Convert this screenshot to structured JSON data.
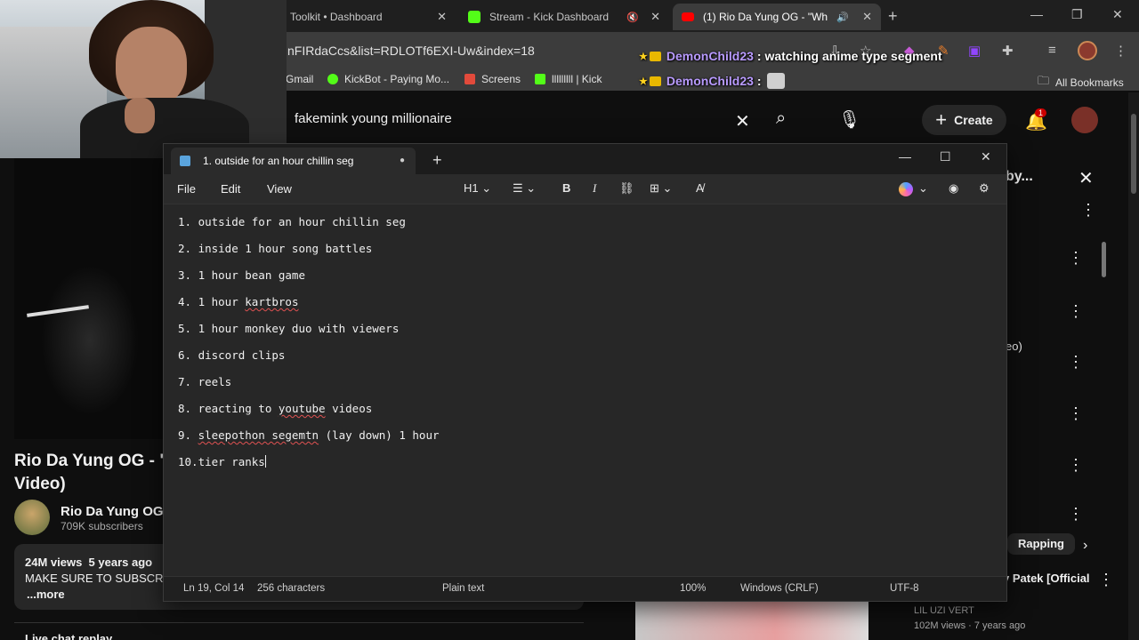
{
  "browser": {
    "tabs": [
      {
        "title": "Toolkit • Dashboard",
        "close": "✕"
      },
      {
        "title": "Stream - Kick Dashboard",
        "close": "✕"
      },
      {
        "title": "(1) Rio Da Yung OG - \"Wha",
        "close": "✕"
      }
    ],
    "new_tab": "+",
    "url": "nFIRdaCcs&list=RDLOTf6EXI-Uw&index=18",
    "bookmarks": [
      {
        "label": "Gmail",
        "icon": "gmail-icon"
      },
      {
        "label": "KickBot - Paying Mo...",
        "icon": "kickbot-icon"
      },
      {
        "label": "Screens",
        "icon": "screens-icon"
      },
      {
        "label": "lllllllll | Kick",
        "icon": "kick-icon"
      }
    ],
    "all_bookmarks": "All Bookmarks"
  },
  "chat": [
    {
      "user": "DemonChild23",
      "message": ": watching anime type segment"
    },
    {
      "user": "DemonChild23",
      "message": ":"
    }
  ],
  "youtube": {
    "search_query": "fakemink young millionaire",
    "create_label": "Create",
    "notification_count": "1",
    "video_title_line1": "Rio Da Yung OG - \"",
    "video_title_line2": "Video)",
    "channel_name": "Rio Da Yung OG",
    "subscribers": "709K subscribers",
    "views_line": "24M views  5 years ago",
    "description": "MAKE SURE TO SUBSCRI",
    "more": "...more",
    "live_chat": "Live chat replay",
    "panel_title": "by...",
    "panel_edge_text": "eo)",
    "chip_label": "Rapping",
    "rec_title": "y Patek [Official",
    "rec_channel": "LIL UZI VERT",
    "rec_meta": "102M views · 7 years ago"
  },
  "notepad": {
    "tab_title": "1. outside for an hour chillin seg",
    "menus": [
      "File",
      "Edit",
      "View"
    ],
    "heading_select": "H1",
    "lines": [
      {
        "num": "1. ",
        "text": "outside for an hour chillin seg"
      },
      {
        "num": "2. ",
        "text": "inside 1 hour song battles"
      },
      {
        "num": "3. ",
        "text": "1 hour bean game"
      },
      {
        "num": "4. ",
        "pre": "1 hour ",
        "squig": "kartbros",
        "post": ""
      },
      {
        "num": "5. ",
        "text": "1 hour monkey duo with viewers"
      },
      {
        "num": "6. ",
        "text": "discord clips"
      },
      {
        "num": "7. ",
        "text": "reels"
      },
      {
        "num": "8. ",
        "pre": "reacting to ",
        "squig": "youtube",
        "post": " videos"
      },
      {
        "num": "9. ",
        "pre": "",
        "squig": "sleepothon segemtn",
        "post": " (lay down) 1 hour"
      },
      {
        "num": "10.",
        "text": "tier ranks"
      }
    ],
    "status": {
      "position": "Ln 19, Col 14",
      "characters": "256 characters",
      "format": "Plain text",
      "zoom": "100%",
      "line_ending": "Windows (CRLF)",
      "encoding": "UTF-8"
    }
  }
}
